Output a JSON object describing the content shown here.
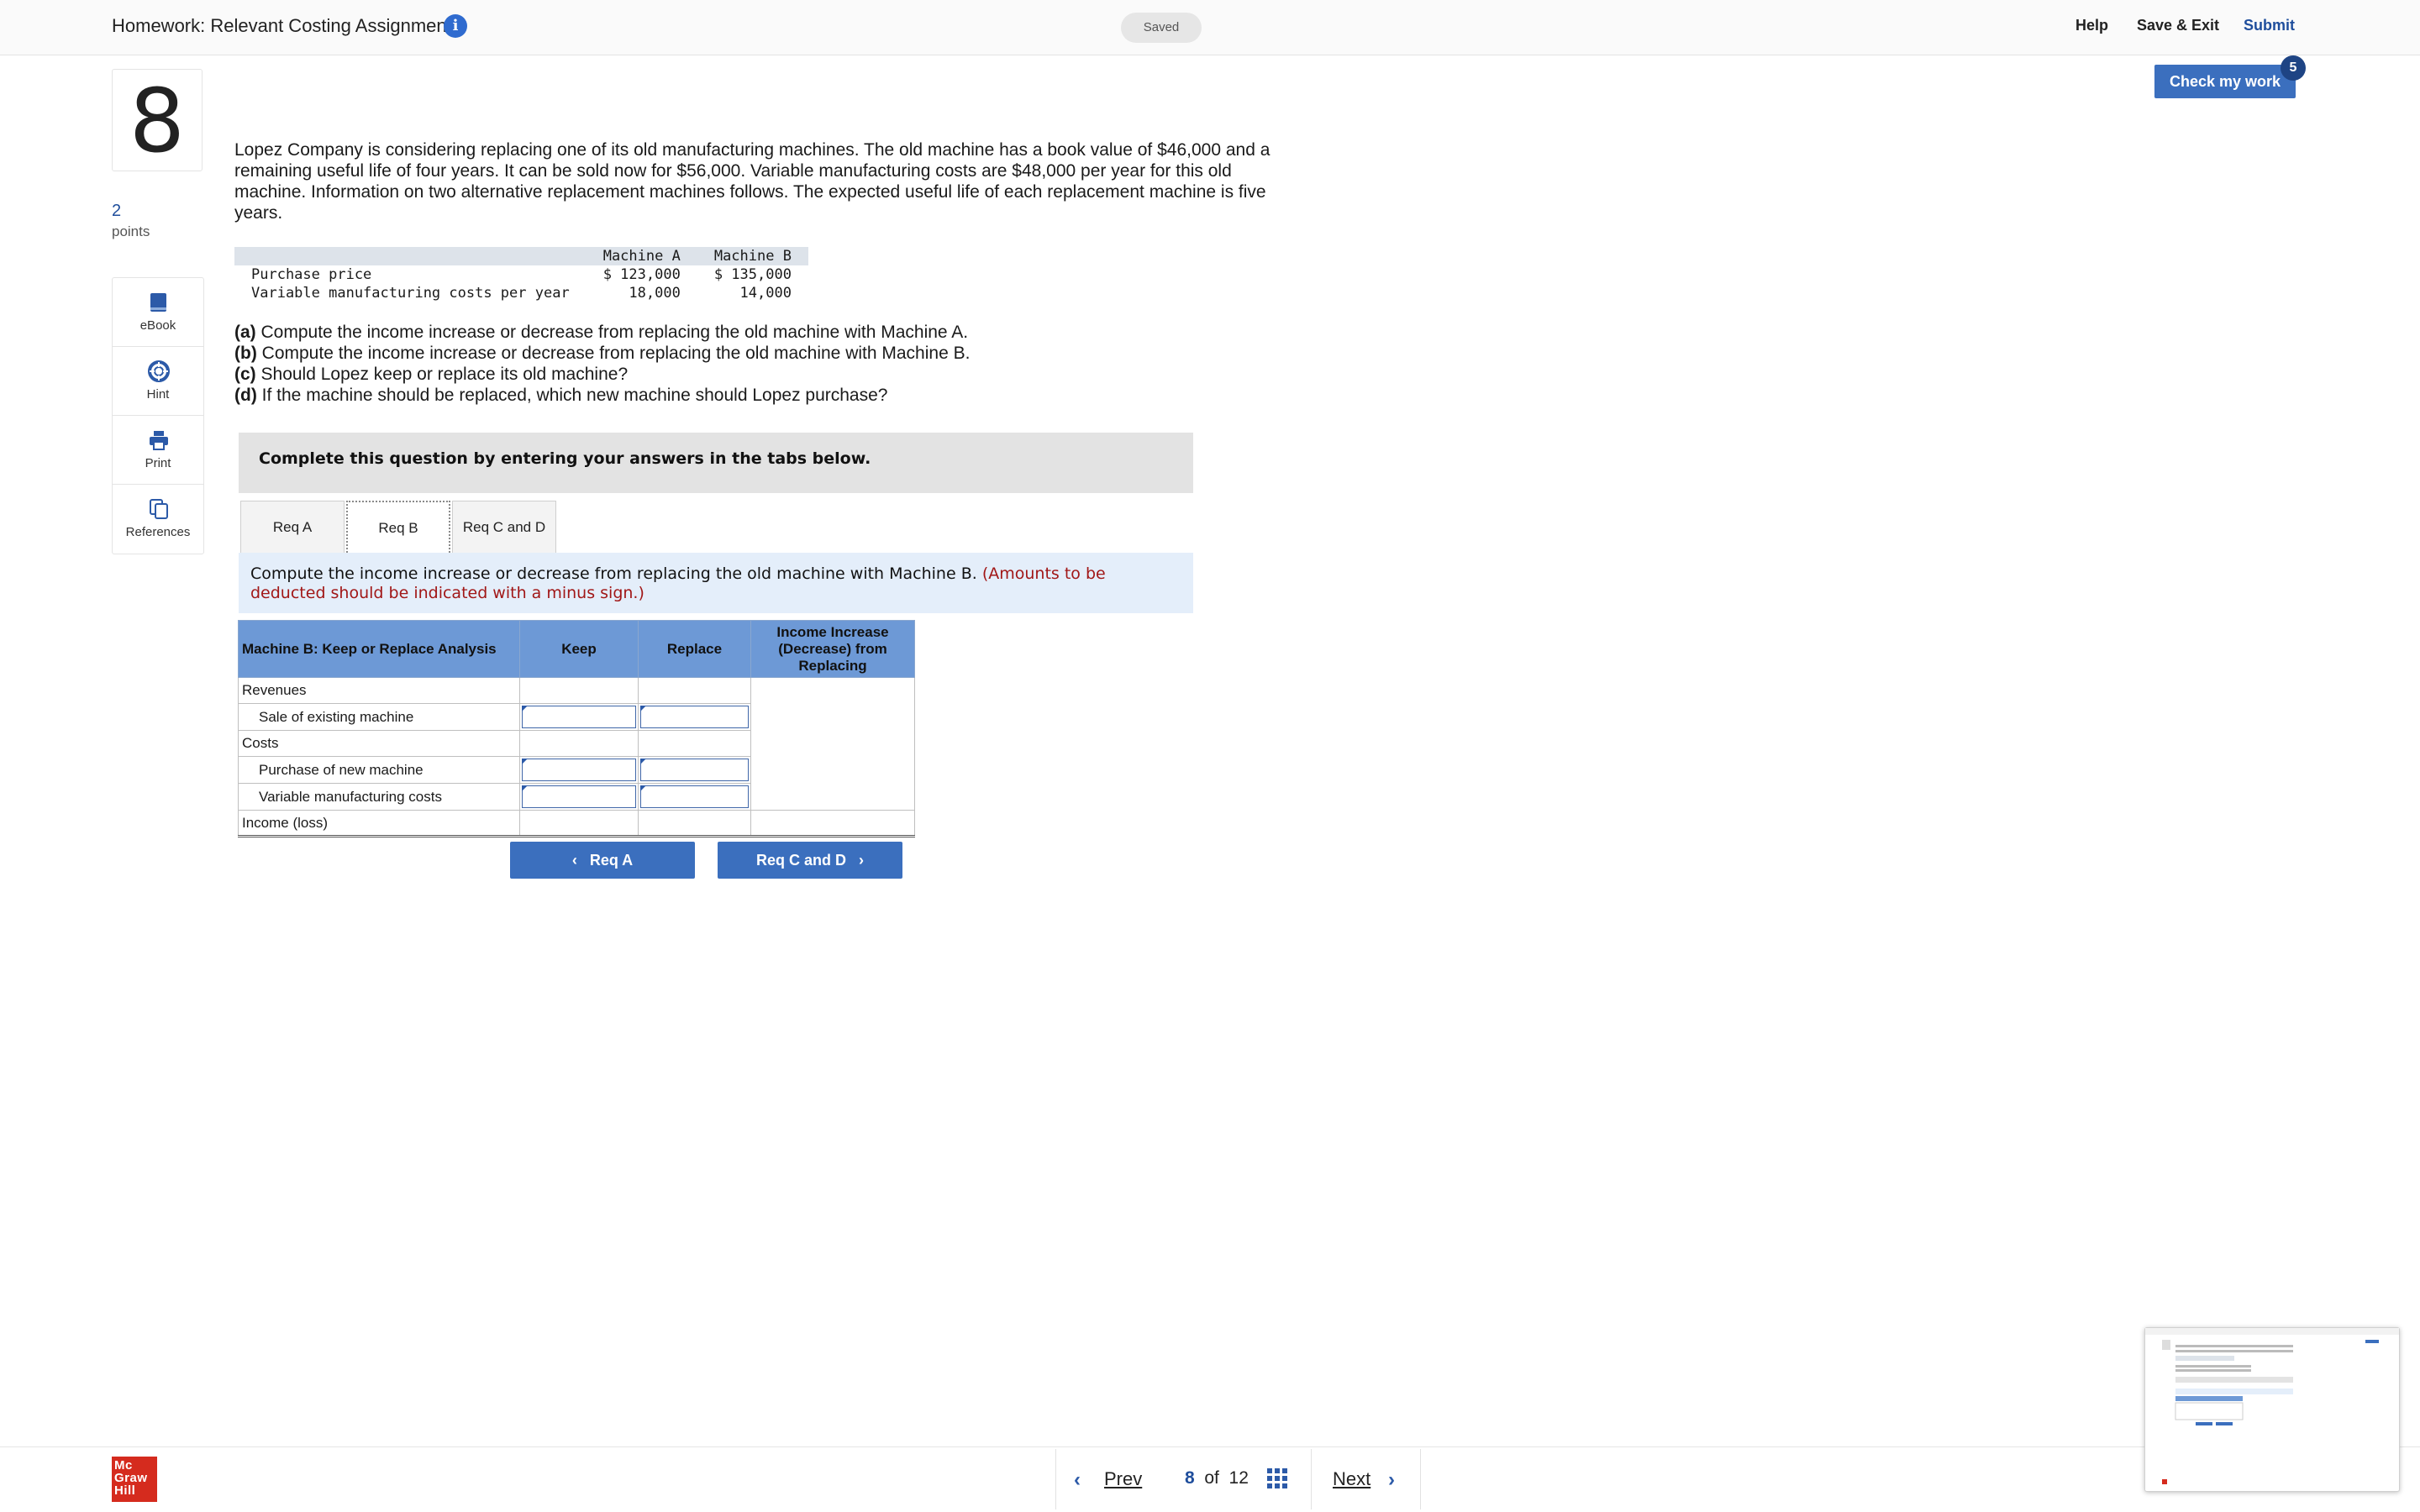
{
  "header": {
    "title": "Homework: Relevant Costing Assignment",
    "info_icon": "i",
    "saved": "Saved",
    "help": "Help",
    "save_exit": "Save & Exit",
    "submit": "Submit"
  },
  "question": {
    "number": "8",
    "points_value": "2",
    "points_label": "points",
    "check_my_work": "Check my work",
    "check_badge": "5"
  },
  "tools": [
    {
      "label": "eBook",
      "icon": "ebook-icon"
    },
    {
      "label": "Hint",
      "icon": "hint-lifebuoy-icon"
    },
    {
      "label": "Print",
      "icon": "printer-icon"
    },
    {
      "label": "References",
      "icon": "references-icon"
    }
  ],
  "intro": "Lopez Company is considering replacing one of its old manufacturing machines. The old machine has a book value of $46,000 and a remaining useful life of four years. It can be sold now for $56,000. Variable manufacturing costs are $48,000 per year for this old machine. Information on two alternative replacement machines follows. The expected useful life of each replacement machine is five years.",
  "machine_table": {
    "headers": [
      "",
      "Machine A",
      "Machine B"
    ],
    "rows": [
      [
        "Purchase price",
        "$ 123,000",
        "$ 135,000"
      ],
      [
        "Variable manufacturing costs per year",
        "18,000",
        "14,000"
      ]
    ]
  },
  "parts": [
    {
      "tag": "(a)",
      "text": " Compute the income increase or decrease from replacing the old machine with Machine A."
    },
    {
      "tag": "(b)",
      "text": " Compute the income increase or decrease from replacing the old machine with Machine B."
    },
    {
      "tag": "(c)",
      "text": " Should Lopez keep or replace its old machine?"
    },
    {
      "tag": "(d)",
      "text": " If the machine should be replaced, which new machine should Lopez purchase?"
    }
  ],
  "complete_bar": "Complete this question by entering your answers in the tabs below.",
  "tabs": [
    "Req A",
    "Req B",
    "Req C and D"
  ],
  "instruction": {
    "text": "Compute the income increase or decrease from replacing the old machine with Machine B.",
    "note": "(Amounts to be deducted should be indicated with a minus sign.)"
  },
  "analysis": {
    "headers": [
      "Machine B: Keep or Replace Analysis",
      "Keep",
      "Replace",
      "Income Increase (Decrease) from Replacing"
    ],
    "rows": [
      "Revenues",
      "Sale of existing machine",
      "Costs",
      "Purchase of new machine",
      "Variable manufacturing costs",
      "Income (loss)"
    ]
  },
  "nav_buttons": {
    "prev": "Req A",
    "next": "Req C and D"
  },
  "footer": {
    "logo": [
      "Mc",
      "Graw",
      "Hill"
    ],
    "prev": "Prev",
    "current": "8",
    "of": "of",
    "total": "12",
    "next": "Next"
  }
}
